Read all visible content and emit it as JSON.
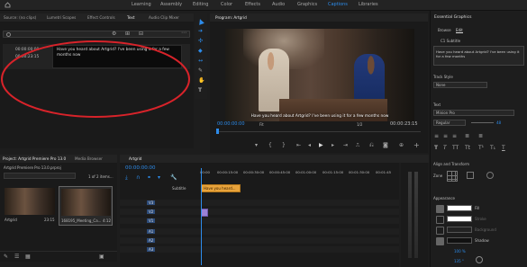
{
  "workspaces": [
    "Learning",
    "Assembly",
    "Editing",
    "Color",
    "Effects",
    "Audio",
    "Graphics",
    "Captions",
    "Libraries"
  ],
  "workspace_active": "Captions",
  "source_tabs": [
    "Source: (no clips)",
    "Lumetri Scopes",
    "Effect Controls",
    "Text",
    "Audio Clip Mixer"
  ],
  "captions": {
    "in_time": "00:00:00:00",
    "out_time": "00:00:23:15",
    "text": "Have you heard about Artgrid? I've been using it for a few months now"
  },
  "program": {
    "title": "Program: Artgrid",
    "subtitle": "Have you heard about Artgrid? I've been using it for a few months now",
    "timecode": "00:00:00:00",
    "fit": "Fit",
    "fraction": "1/2",
    "duration": "00:00:23:15"
  },
  "essential": {
    "title": "Essential Graphics",
    "tabs": [
      "Browse",
      "Edit"
    ],
    "layer": "C1 Subtitle",
    "text_preview": "Have you heard about Artgrid? I've been using it for a few months",
    "track_style_label": "Track Style",
    "track_style_value": "None",
    "text_label": "Text",
    "font": "Minion Pro",
    "font_style": "Regular",
    "font_size": "48",
    "align_label": "Align and Transform",
    "appearance_label": "Appearance",
    "fill_label": "Fill",
    "stroke_label": "Stroke",
    "background_label": "Background",
    "shadow_label": "Shadow",
    "shadow_value_1": "100 %",
    "shadow_value_2": "135 °",
    "zone_label": "Zone"
  },
  "project": {
    "tabs": [
      "Project: Artgrid Premiere Pro 13.0",
      "Media Browser"
    ],
    "file": "Artgrid Premiere Pro 13.0.prproj",
    "count": "1 of 2 items...",
    "items": [
      {
        "name": "Artgrid",
        "duration": "23:15"
      },
      {
        "name": "168195_Meeting_Ca...",
        "duration": "4:12"
      }
    ]
  },
  "timeline": {
    "tab": "Artgrid",
    "timecode": "00:00:00:00",
    "ruler": [
      "00:00",
      "00:00:15:00",
      "00:00:30:00",
      "00:00:45:00",
      "00:01:00:00",
      "00:01:15:00",
      "00:01:30:00",
      "00:01:45"
    ],
    "subtitle_label": "Subtitle",
    "caption_clip": "Have you heard...",
    "tracks": [
      "V3",
      "V2",
      "V1",
      "A1",
      "A2",
      "A3"
    ]
  },
  "colors": {
    "accent": "#2d8ceb",
    "caption_clip": "#e8a33b",
    "video_clip": "#9b82d6",
    "red_annotation": "#d8232a"
  }
}
